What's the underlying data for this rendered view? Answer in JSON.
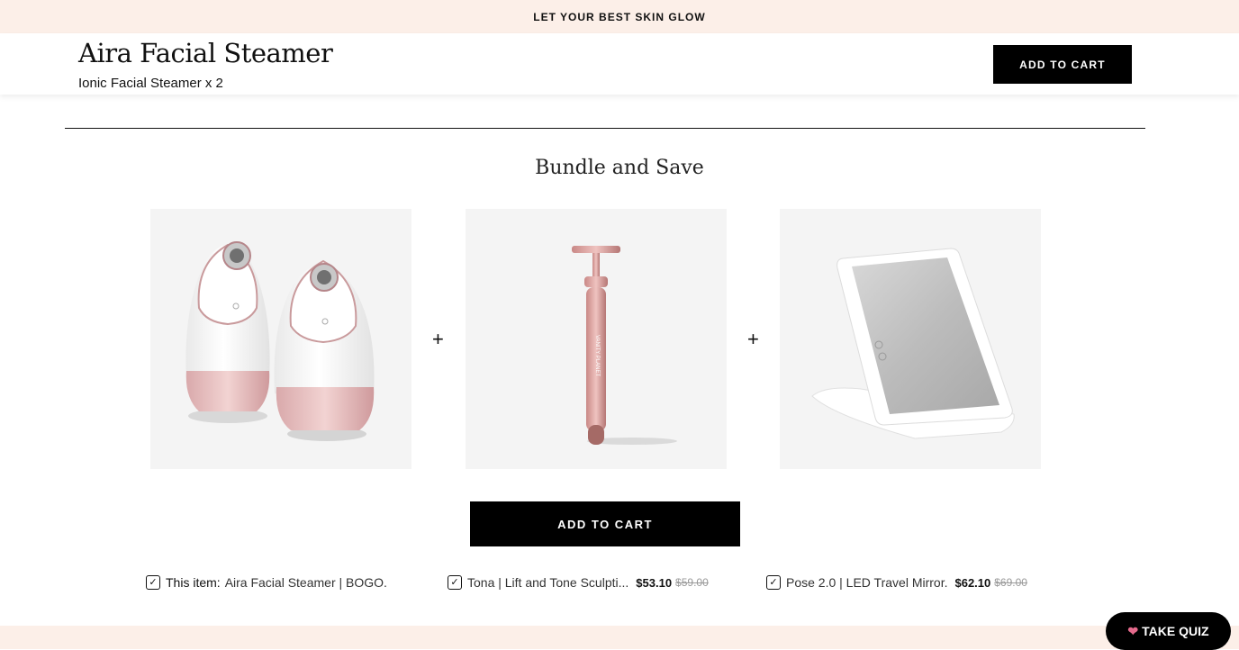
{
  "announcement": "LET YOUR BEST SKIN GLOW",
  "sticky_header": {
    "title": "Aira Facial Steamer",
    "subtitle": "Ionic Facial Steamer x 2",
    "cart_label": "ADD TO CART"
  },
  "bundle": {
    "title": "Bundle and Save",
    "plus": "+",
    "cart_label": "ADD TO CART",
    "products": [
      {
        "image_name": "facial-steamer-pair-image"
      },
      {
        "image_name": "sculpting-bar-image"
      },
      {
        "image_name": "travel-mirror-image"
      }
    ],
    "items": [
      {
        "checked": true,
        "label": "This item:",
        "name": "Aira Facial Steamer | BOGO.",
        "price": "",
        "old_price": ""
      },
      {
        "checked": true,
        "label": "",
        "name": "Tona | Lift and Tone Sculpti...",
        "price": "$53.10",
        "old_price": "$59.00"
      },
      {
        "checked": true,
        "label": "",
        "name": "Pose 2.0 | LED Travel Mirror.",
        "price": "$62.10",
        "old_price": "$69.00"
      }
    ]
  },
  "quiz_button": {
    "icon": "heart-icon",
    "label": "TAKE QUIZ"
  },
  "colors": {
    "accent_band": "#fcefe8",
    "primary_button": "#000000",
    "rose_gold": "#d9a3a6"
  }
}
